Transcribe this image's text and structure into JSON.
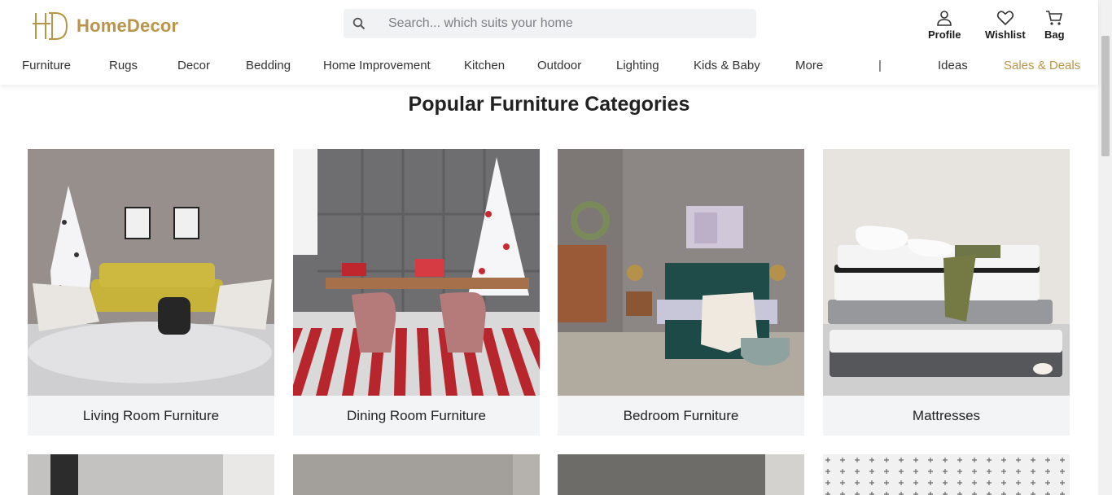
{
  "brand": {
    "name": "HomeDecor",
    "mark": "HD",
    "color": "#b8954a"
  },
  "search": {
    "placeholder": "Search... which suits your home",
    "value": "",
    "icon": "search-icon"
  },
  "header_actions": [
    {
      "label": "Profile",
      "icon": "user-icon"
    },
    {
      "label": "Wishlist",
      "icon": "heart-icon"
    },
    {
      "label": "Bag",
      "icon": "shopping-cart-icon"
    }
  ],
  "nav": {
    "items": [
      "Furniture",
      "Rugs",
      "Decor",
      "Bedding",
      "Home Improvement",
      "Kitchen",
      "Outdoor",
      "Lighting",
      "Kids & Baby",
      "More"
    ],
    "separator": "|",
    "ideas": "Ideas",
    "deals": "Sales & Deals"
  },
  "section": {
    "title": "Popular Furniture Categories"
  },
  "categories": [
    {
      "label": "Living Room Furniture"
    },
    {
      "label": "Dining Room Furniture"
    },
    {
      "label": "Bedroom Furniture"
    },
    {
      "label": "Mattresses"
    }
  ]
}
